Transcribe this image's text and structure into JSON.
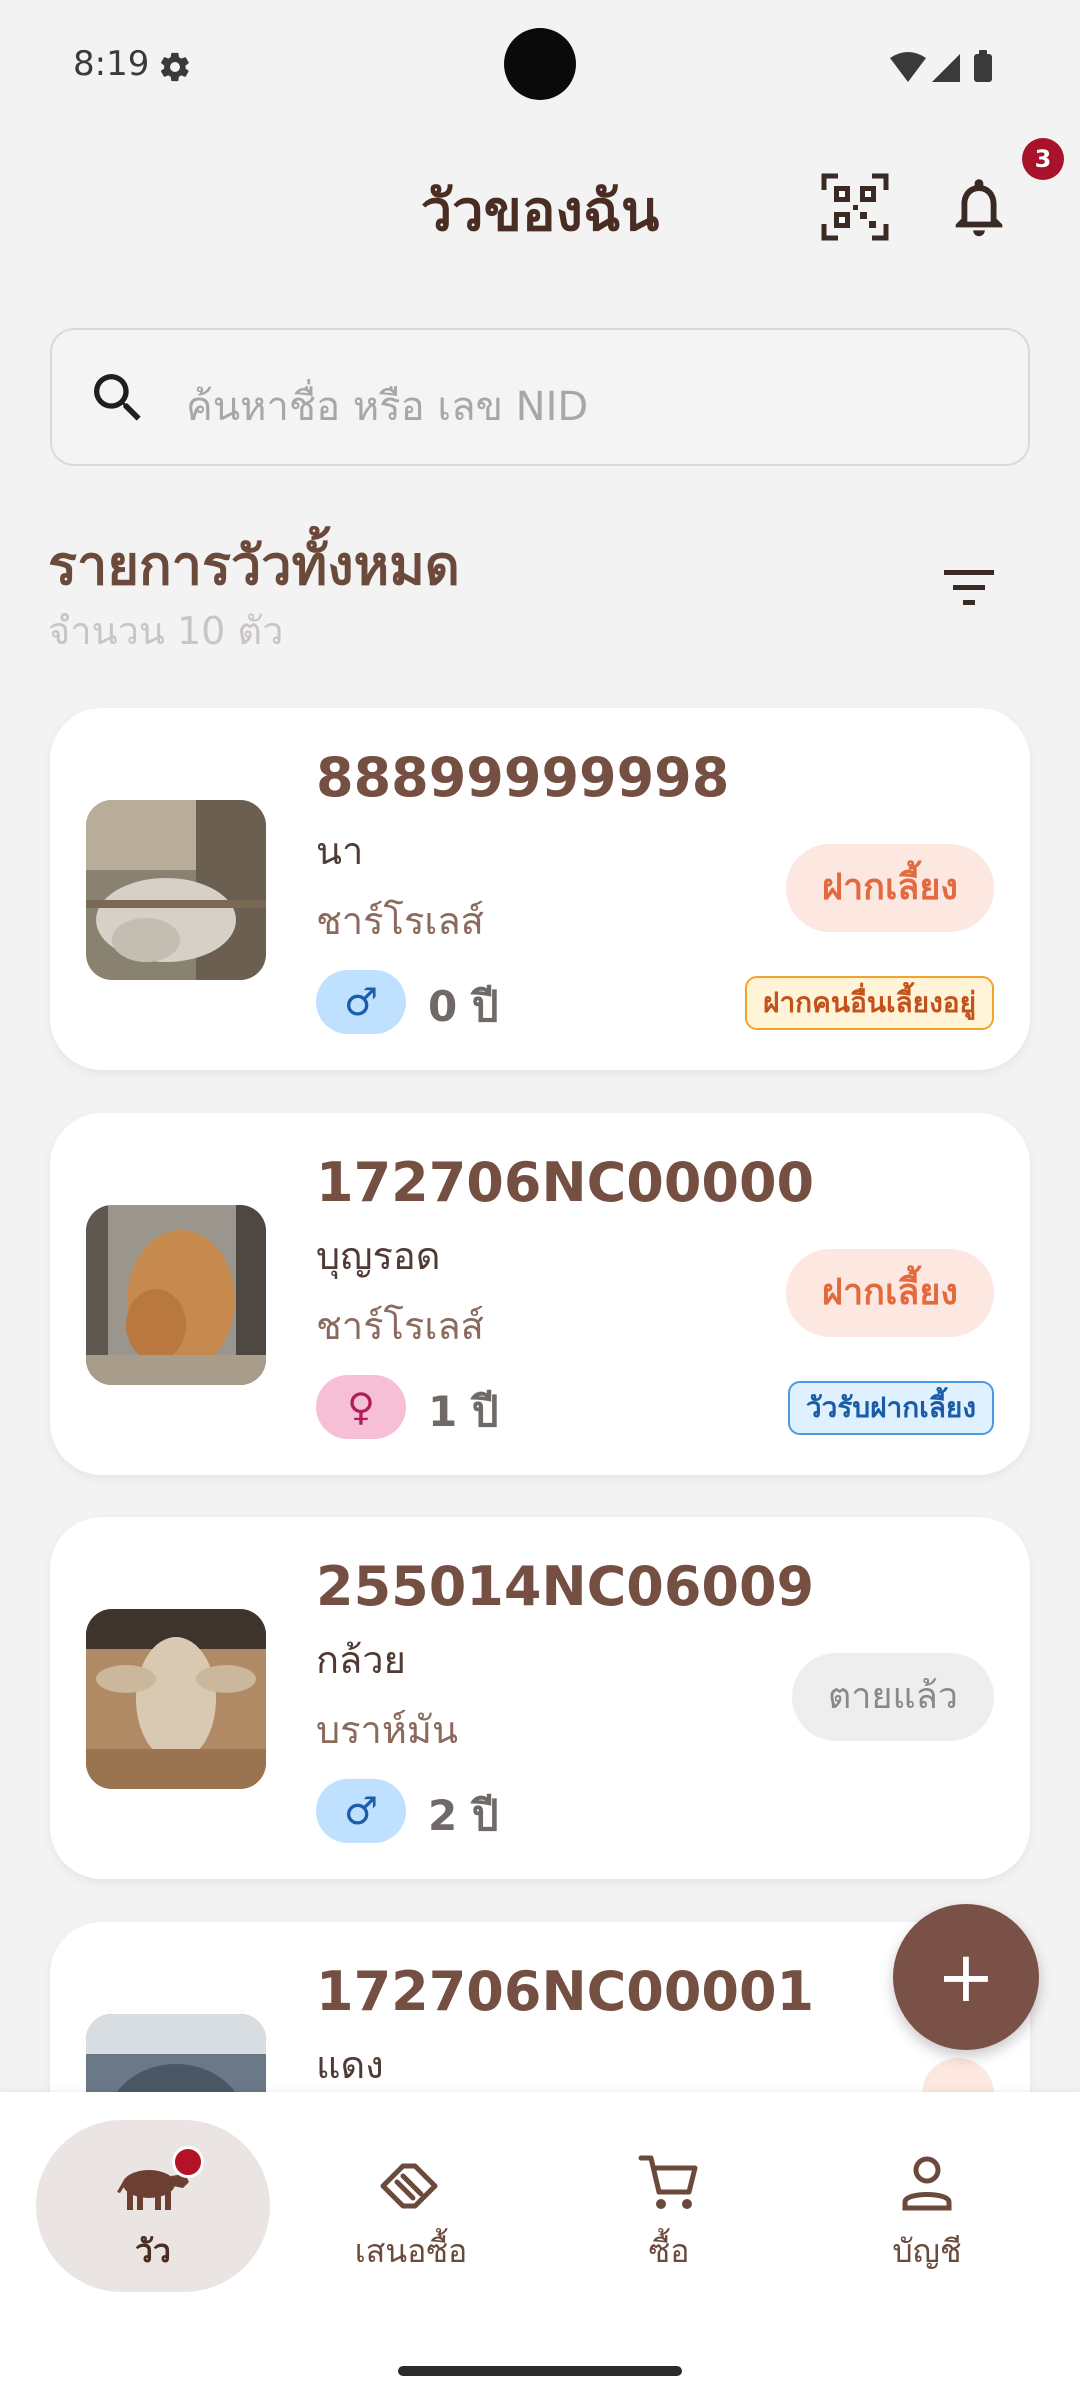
{
  "status_bar": {
    "time": "8:19"
  },
  "header": {
    "title": "วัวของฉัน",
    "notification_count": "3"
  },
  "search": {
    "placeholder": "ค้นหาชื่อ หรือ เลข NID"
  },
  "section": {
    "title": "รายการวัวทั้งหมด",
    "count_text": "จำนวน 10 ตัว"
  },
  "cows": [
    {
      "id": "88899999998",
      "name": "นา",
      "breed": "ชาร์โรเลส์",
      "sex_symbol": "♂",
      "age": "0 ปี",
      "status": "ฝากเลี้ยง",
      "tag": "ฝากคนอื่นเลี้ยงอยู่"
    },
    {
      "id": "172706NC00000",
      "name": "บุญรอด",
      "breed": "ชาร์โรเลส์",
      "sex_symbol": "♀",
      "age": "1 ปี",
      "status": "ฝากเลี้ยง",
      "tag": "วัวรับฝากเลี้ยง"
    },
    {
      "id": "255014NC06009",
      "name": "กล้วย",
      "breed": "บราห์มัน",
      "sex_symbol": "♂",
      "age": "2 ปี",
      "status": "ตายแล้ว"
    },
    {
      "id": "172706NC00001",
      "name": "แดง"
    }
  ],
  "fab": {
    "label": "+"
  },
  "nav": [
    {
      "label": "วัว",
      "icon": "cow-icon"
    },
    {
      "label": "เสนอซื้อ",
      "icon": "handshake-icon"
    },
    {
      "label": "ซื้อ",
      "icon": "cart-icon"
    },
    {
      "label": "บัญชี",
      "icon": "person-icon"
    }
  ],
  "colors": {
    "brand": "#7a5146",
    "accent_orange": "#e26a3f",
    "badge_red": "#a8122a",
    "background": "#f4f3f3"
  }
}
